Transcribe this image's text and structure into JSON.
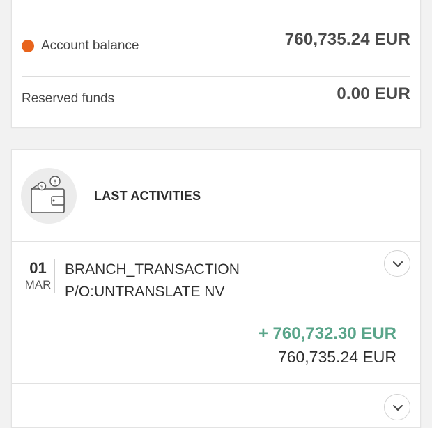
{
  "balance": {
    "account_label": "Account balance",
    "account_amount": "760,735.24 EUR",
    "reserved_label": "Reserved funds",
    "reserved_amount": "0.00 EUR",
    "dot_color": "#e8641c"
  },
  "activities": {
    "title": "LAST ACTIVITIES",
    "icon": "wallet-icon",
    "transactions": [
      {
        "day": "01",
        "month": "MAR",
        "description": "BRANCH_TRANSACTION P/O:UNTRANSLATE NV",
        "amount": "+ 760,732.30 EUR",
        "balance_after": "760,735.24 EUR",
        "amount_color": "#5aa58a"
      }
    ]
  }
}
